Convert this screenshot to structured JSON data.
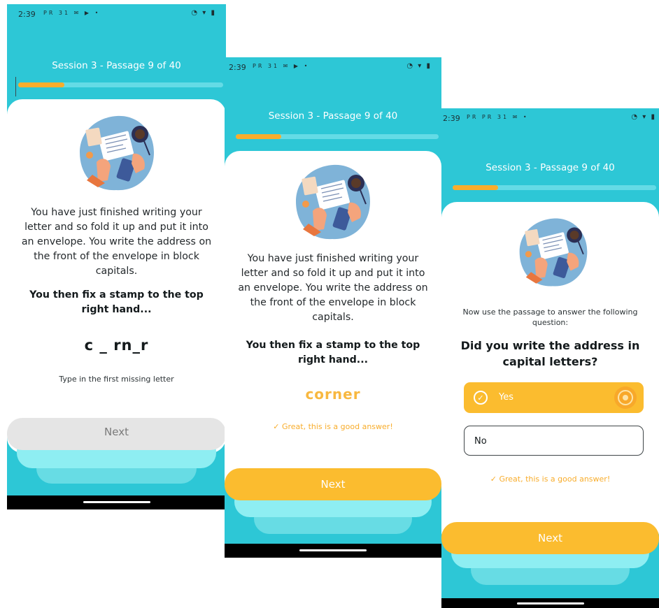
{
  "colors": {
    "teal": "#2dc7d6",
    "orange": "#fbbc2f",
    "progress": "#f8ad2c",
    "light_teal": "#8eeef2"
  },
  "statusbar": {
    "time": "2:39",
    "icons_left_1": "PR 31 ✉ ▶ •",
    "icons_left_3": "PR PR 31 ✉ •",
    "icons_right": "◔ ▾ ▮"
  },
  "session_title": "Session 3 - Passage 9 of 40",
  "progress_fraction": 0.225,
  "illustration_icon": "writing-desk-illustration",
  "passage": "You have just finished writing your letter and so fold it up and put it into an envelope. You write the address on the front of the envelope in block capitals.",
  "prompt": "You then fix a stamp to the top right hand...",
  "screen1": {
    "gap_word": "c _ rn_r",
    "hint": "Type in the first missing letter",
    "next_label": "Next"
  },
  "screen2": {
    "answer_word": "corner",
    "feedback": "✓ Great, this is a good answer!",
    "next_label": "Next"
  },
  "screen3": {
    "instruction": "Now use the passage to answer the following question:",
    "question": "Did you write the address in capital letters?",
    "options": [
      {
        "label": "Yes",
        "selected": true
      },
      {
        "label": "No",
        "selected": false
      }
    ],
    "check_glyph": "✓",
    "feedback": "✓ Great, this is a good answer!",
    "next_label": "Next"
  }
}
